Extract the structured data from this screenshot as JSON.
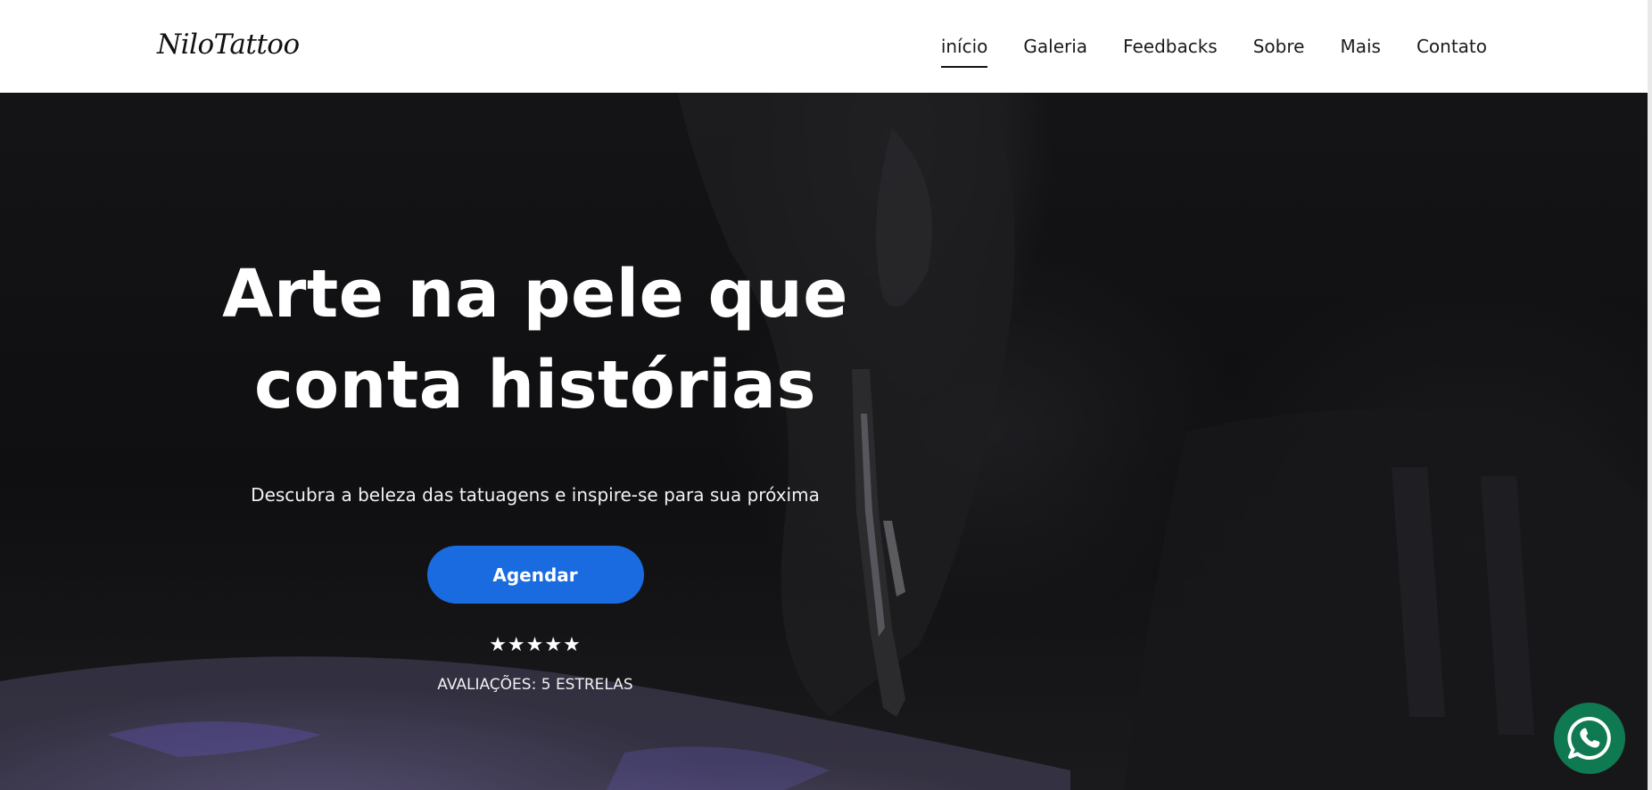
{
  "header": {
    "logo_text": "NiloTattoo",
    "nav": [
      {
        "label": "início",
        "active": true
      },
      {
        "label": "Galeria",
        "active": false
      },
      {
        "label": "Feedbacks",
        "active": false
      },
      {
        "label": "Sobre",
        "active": false
      },
      {
        "label": "Mais",
        "active": false
      },
      {
        "label": "Contato",
        "active": false
      }
    ]
  },
  "hero": {
    "title_line1": "Arte na pele que",
    "title_line2": "conta histórias",
    "subtitle": "Descubra a beleza das tatuagens e inspire-se para sua próxima",
    "cta_label": "Agendar",
    "stars": "★★★★★",
    "rating_label": "AVALIAÇÕES: 5 ESTRELAS"
  },
  "floating": {
    "icon": "whatsapp-icon"
  },
  "colors": {
    "accent": "#1a6be0",
    "whatsapp": "#0f7a52",
    "hero_bg": "#141416",
    "header_bg": "#ffffff"
  }
}
